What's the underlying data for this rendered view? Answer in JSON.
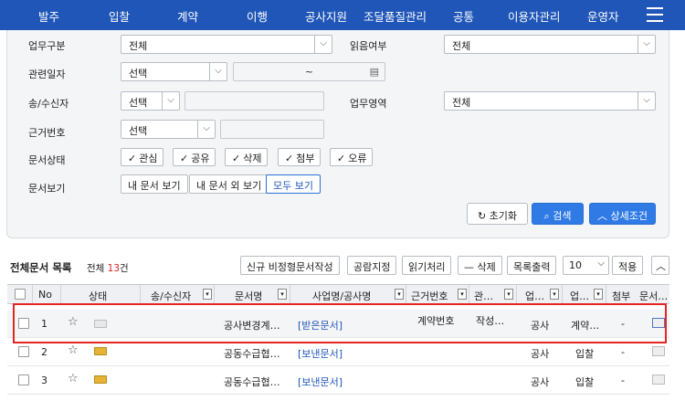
{
  "nav": {
    "items": [
      "발주",
      "입찰",
      "계약",
      "이행",
      "공사지원",
      "조달품질관리",
      "공통",
      "이용자관리",
      "운영자"
    ]
  },
  "filters": {
    "work_type_label": "업무구분",
    "work_type_value": "전체",
    "read_status_label": "읽음여부",
    "read_status_value": "전체",
    "date_label": "관련일자",
    "date_select": "선택",
    "date_range_sep": "~",
    "sender_label": "송/수신자",
    "sender_select": "선택",
    "work_area_label": "업무영역",
    "work_area_value": "전체",
    "basis_label": "근거번호",
    "basis_select": "선택",
    "doc_status_label": "문서상태",
    "doc_status_chips": [
      "관심",
      "공유",
      "삭제",
      "첨부",
      "오류"
    ],
    "doc_view_label": "문서보기",
    "view_buttons": [
      "내 문서 보기",
      "내 문서 외 보기",
      "모두 보기"
    ],
    "reset_label": "초기화",
    "search_label": "검색",
    "advanced_label": "상세조건"
  },
  "list": {
    "title": "전체문서 목록",
    "count_prefix": "전체",
    "count_value": "13",
    "count_suffix": "건",
    "toolbar": {
      "new_doc": "신규 비정형문서작성",
      "public": "공람지정",
      "mark_read": "읽기처리",
      "delete": "— 삭제",
      "print": "목록출력",
      "page_size": "10",
      "apply": "적용"
    },
    "columns": [
      "No",
      "상태",
      "송/수신자",
      "문서명",
      "사업명/공사명",
      "근거번호",
      "관…",
      "업…",
      "업…",
      "첨부",
      "문서…"
    ],
    "rows": [
      {
        "no": "1",
        "doc_name": "공사변경계…",
        "project": "[받은문서]",
        "basis": "계약번호",
        "rel": "작성…",
        "area": "공사",
        "task": "계약…",
        "attach": "-"
      },
      {
        "no": "2",
        "doc_name": "공동수급협…",
        "project": "[보낸문서]",
        "basis": "",
        "rel": "",
        "area": "공사",
        "task": "입찰",
        "attach": "-"
      },
      {
        "no": "3",
        "doc_name": "공동수급협…",
        "project": "[보낸문서]",
        "basis": "",
        "rel": "",
        "area": "공사",
        "task": "입찰",
        "attach": "-"
      }
    ]
  },
  "colors": {
    "nav_bg": "#1f56b8",
    "primary": "#2f7ae5",
    "highlight": "#e52424"
  }
}
